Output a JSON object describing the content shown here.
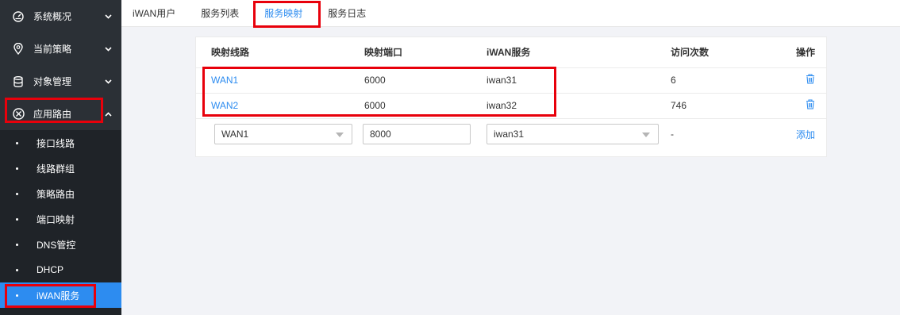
{
  "sidebar": {
    "top_items": [
      {
        "label": "系统概况",
        "icon": "dashboard-gauge-icon"
      },
      {
        "label": "当前策略",
        "icon": "location-pin-icon"
      },
      {
        "label": "对象管理",
        "icon": "database-icon"
      }
    ],
    "expanded_item": {
      "label": "应用路由",
      "icon": "routing-circle-icon"
    },
    "sub_items": [
      {
        "label": "接口线路"
      },
      {
        "label": "线路群组"
      },
      {
        "label": "策略路由"
      },
      {
        "label": "端口映射"
      },
      {
        "label": "DNS管控"
      },
      {
        "label": "DHCP"
      },
      {
        "label": "iWAN服务",
        "active": true
      }
    ]
  },
  "tabs": [
    {
      "label": "iWAN用户"
    },
    {
      "label": "服务列表"
    },
    {
      "label": "服务映射",
      "active": true
    },
    {
      "label": "服务日志"
    }
  ],
  "table": {
    "headers": [
      "映射线路",
      "映射端口",
      "iWAN服务",
      "访问次数",
      "操作"
    ],
    "rows": [
      {
        "line": "WAN1",
        "port": "6000",
        "service": "iwan31",
        "visits": "6"
      },
      {
        "line": "WAN2",
        "port": "6000",
        "service": "iwan32",
        "visits": "746"
      }
    ],
    "form": {
      "line_value": "WAN1",
      "port_value": "8000",
      "service_value": "iwan31",
      "visits_value": "-",
      "add_label": "添加"
    }
  },
  "colors": {
    "accent": "#2d8cf0",
    "sidebar_bg": "#1f2328",
    "highlight": "#e8000b"
  }
}
